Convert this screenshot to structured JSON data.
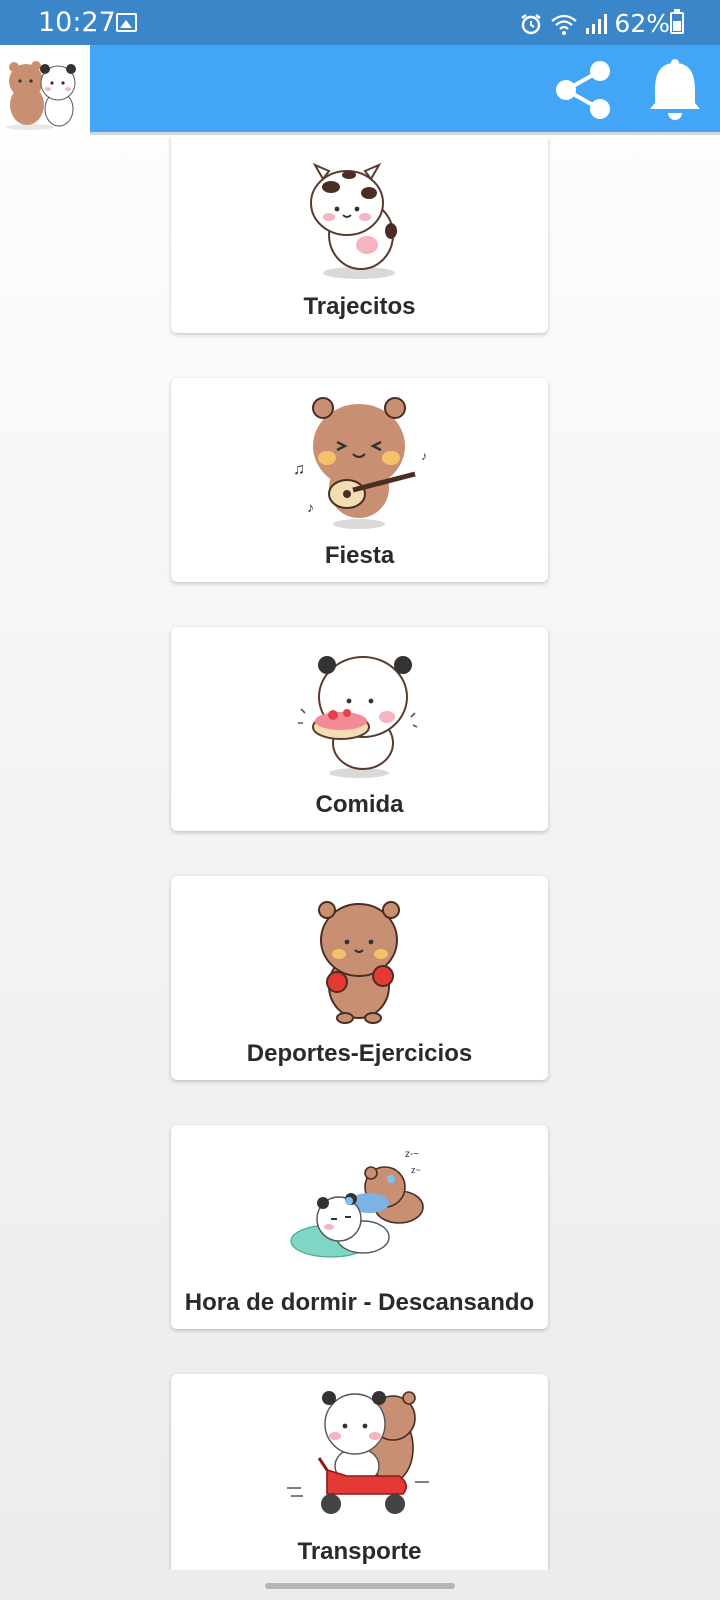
{
  "status_bar": {
    "time": "10:27",
    "battery_text": "62%"
  },
  "app_bar": {
    "logo_icon": "bear-panda-logo",
    "share_icon": "share-icon",
    "notify_icon": "bell-icon",
    "color": "#42a5f5"
  },
  "categories": [
    {
      "label": "Trajecitos",
      "art": "panda-cow-costume"
    },
    {
      "label": "Fiesta",
      "art": "bear-guitar"
    },
    {
      "label": "Comida",
      "art": "panda-cake"
    },
    {
      "label": "Deportes-Ejercicios",
      "art": "bear-boxing"
    },
    {
      "label": "Hora de dormir - Descansando",
      "art": "bear-panda-sleeping"
    },
    {
      "label": "Transporte",
      "art": "bear-panda-scooter"
    }
  ]
}
